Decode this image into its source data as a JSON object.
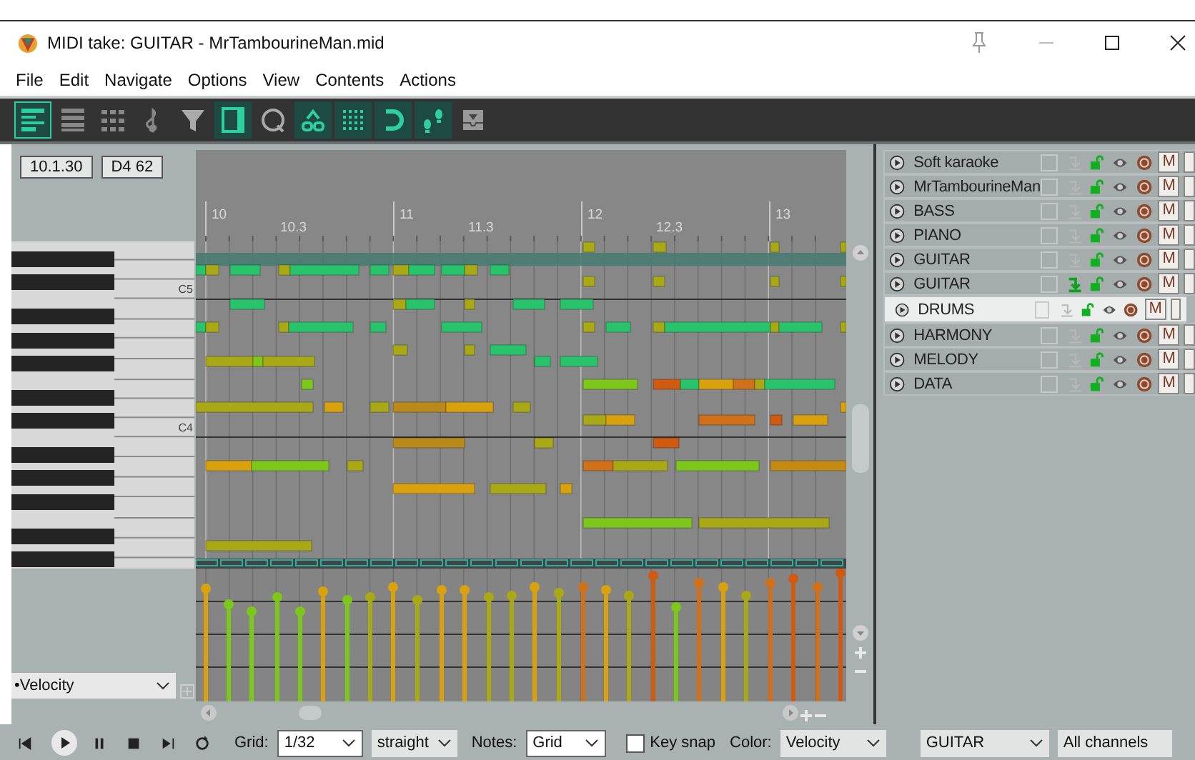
{
  "window": {
    "title": "MIDI take: GUITAR - MrTambourineMan.mid"
  },
  "menu": [
    "File",
    "Edit",
    "Navigate",
    "Options",
    "View",
    "Contents",
    "Actions"
  ],
  "toolbar": [
    {
      "kind": "piano-roll",
      "on": true
    },
    {
      "kind": "named-notes",
      "on": false
    },
    {
      "kind": "event-list",
      "on": false
    },
    {
      "kind": "clef",
      "on": false
    },
    {
      "kind": "filter",
      "on": false
    },
    {
      "kind": "square",
      "on": true
    },
    {
      "kind": "loop",
      "on": false
    },
    {
      "kind": "link",
      "on": true
    },
    {
      "kind": "dots",
      "on": true
    },
    {
      "kind": "magnet",
      "on": true
    },
    {
      "kind": "steps",
      "on": true
    },
    {
      "kind": "inbox",
      "on": false
    }
  ],
  "position": {
    "time": "10.1.30",
    "pitch": "D4  62"
  },
  "ruler": [
    {
      "label": "10",
      "kind": "bar"
    },
    {
      "label": "10.3",
      "kind": "beat"
    },
    {
      "label": "11",
      "kind": "bar"
    },
    {
      "label": "11.3",
      "kind": "beat"
    },
    {
      "label": "12",
      "kind": "bar"
    },
    {
      "label": "12.3",
      "kind": "beat"
    },
    {
      "label": "13",
      "kind": "bar"
    }
  ],
  "piano": {
    "octave_labels": [
      "C5",
      "C4"
    ]
  },
  "lane": {
    "value": "•Velocity"
  },
  "tracks": [
    {
      "name": "Soft karaoke",
      "selected": false,
      "input_active": false,
      "mute_label": "M"
    },
    {
      "name": "MrTambourineMan",
      "selected": false,
      "input_active": false,
      "mute_label": "M"
    },
    {
      "name": "BASS",
      "selected": false,
      "input_active": false,
      "mute_label": "M"
    },
    {
      "name": "PIANO",
      "selected": false,
      "input_active": false,
      "mute_label": "M"
    },
    {
      "name": "GUITAR",
      "selected": false,
      "input_active": false,
      "mute_label": "M"
    },
    {
      "name": "GUITAR",
      "selected": false,
      "input_active": true,
      "mute_label": "M"
    },
    {
      "name": "DRUMS",
      "selected": true,
      "input_active": false,
      "mute_label": "M"
    },
    {
      "name": "HARMONY",
      "selected": false,
      "input_active": false,
      "mute_label": "M"
    },
    {
      "name": "MELODY",
      "selected": false,
      "input_active": false,
      "mute_label": "M"
    },
    {
      "name": "DATA",
      "selected": false,
      "input_active": false,
      "mute_label": "M"
    }
  ],
  "bottom_bar": {
    "grid_label": "Grid:",
    "grid_value": "1/32",
    "swing_value": "straight",
    "notes_label": "Notes:",
    "notes_value": "Grid",
    "key_snap": {
      "label": "Key snap",
      "checked": false
    },
    "color_label": "Color:",
    "color_value": "Velocity",
    "track_value": "GUITAR",
    "channel_value": "All channels"
  }
}
